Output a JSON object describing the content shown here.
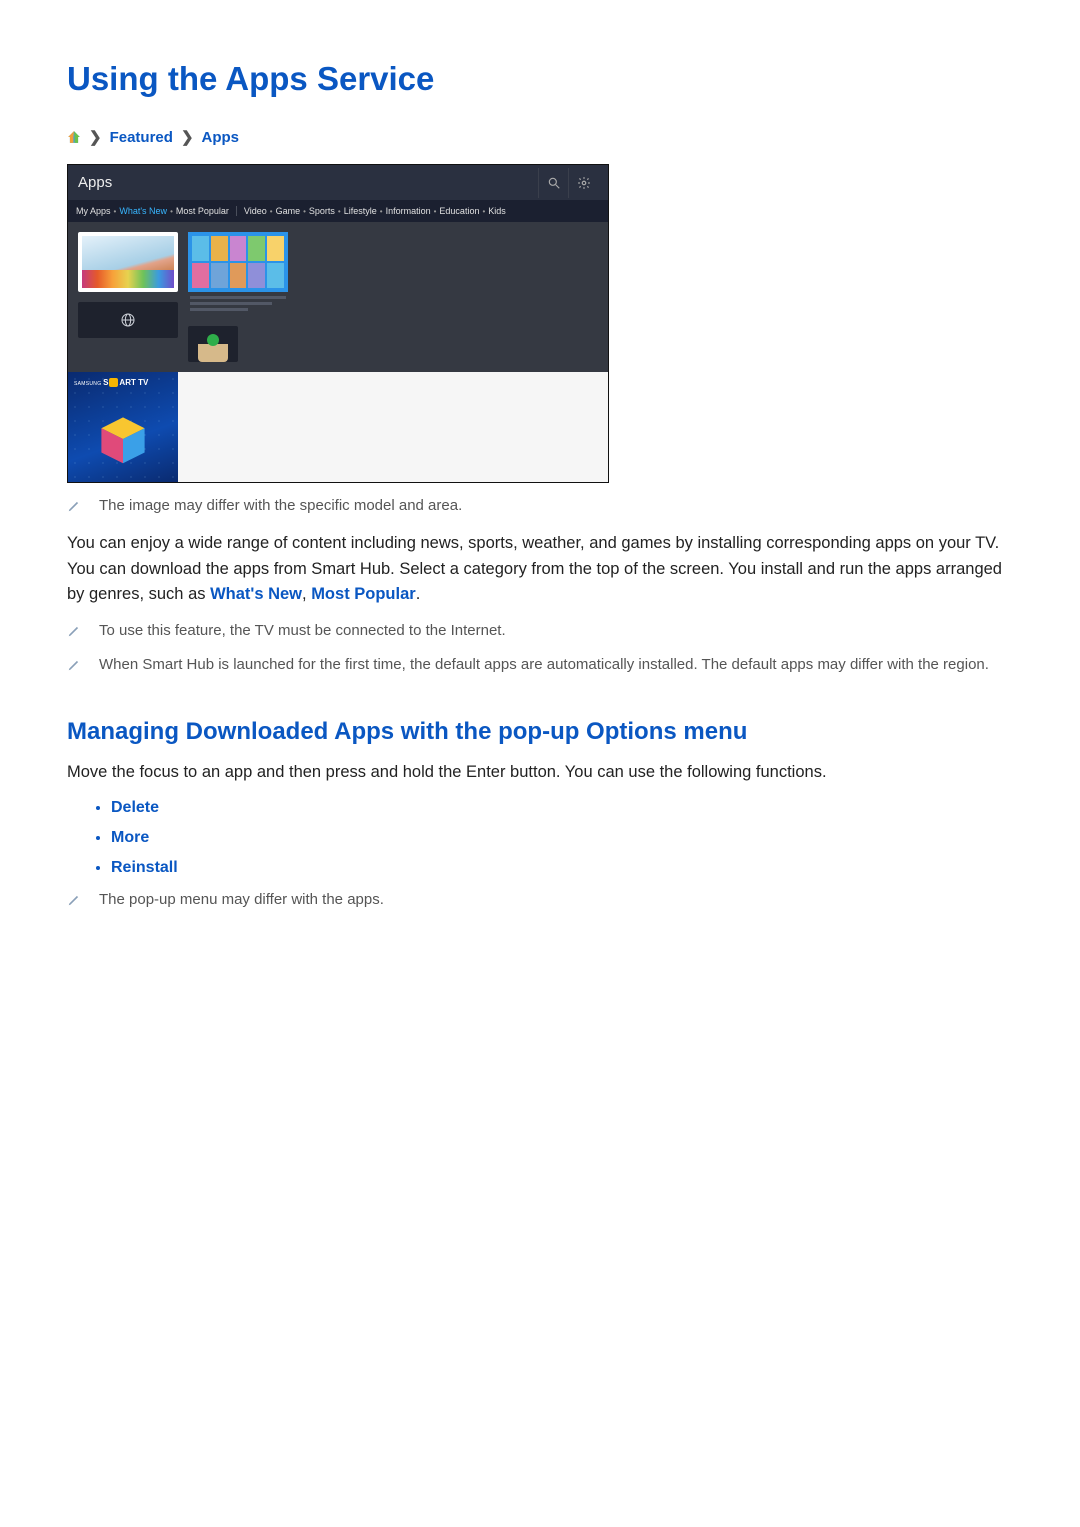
{
  "page": {
    "title": "Using the Apps Service"
  },
  "breadcrumb": {
    "item1": "Featured",
    "item2": "Apps"
  },
  "tv": {
    "title": "Apps",
    "tabs": {
      "my_apps": "My Apps",
      "whats_new": "What's New",
      "most_popular": "Most Popular",
      "video": "Video",
      "game": "Game",
      "sports": "Sports",
      "lifestyle": "Lifestyle",
      "information": "Information",
      "education": "Education",
      "kids": "Kids"
    },
    "brand_prefix": "SAMSUNG ",
    "brand_left": "S",
    "brand_right": "ART TV"
  },
  "notes": {
    "image_differ": "The image may differ with the specific model and area.",
    "internet": "To use this feature, the TV must be connected to the Internet.",
    "default_apps": "When Smart Hub is launched for the first time, the default apps are automatically installed. The default apps may differ with the region.",
    "popup_differ": "The pop-up menu may differ with the apps."
  },
  "paragraph1": {
    "pre": "You can enjoy a wide range of content including news, sports, weather, and games by installing corresponding apps on your TV. You can download the apps from Smart Hub. Select a category from the top of the screen. You install and run the apps arranged by genres, such as ",
    "link1": "What's New",
    "mid": ", ",
    "link2": "Most Popular",
    "post": "."
  },
  "section2": {
    "title": "Managing Downloaded Apps with the pop-up Options menu",
    "body": "Move the focus to an app and then press and hold the Enter button. You can use the following functions."
  },
  "options": {
    "delete": "Delete",
    "more": "More",
    "reinstall": "Reinstall"
  }
}
